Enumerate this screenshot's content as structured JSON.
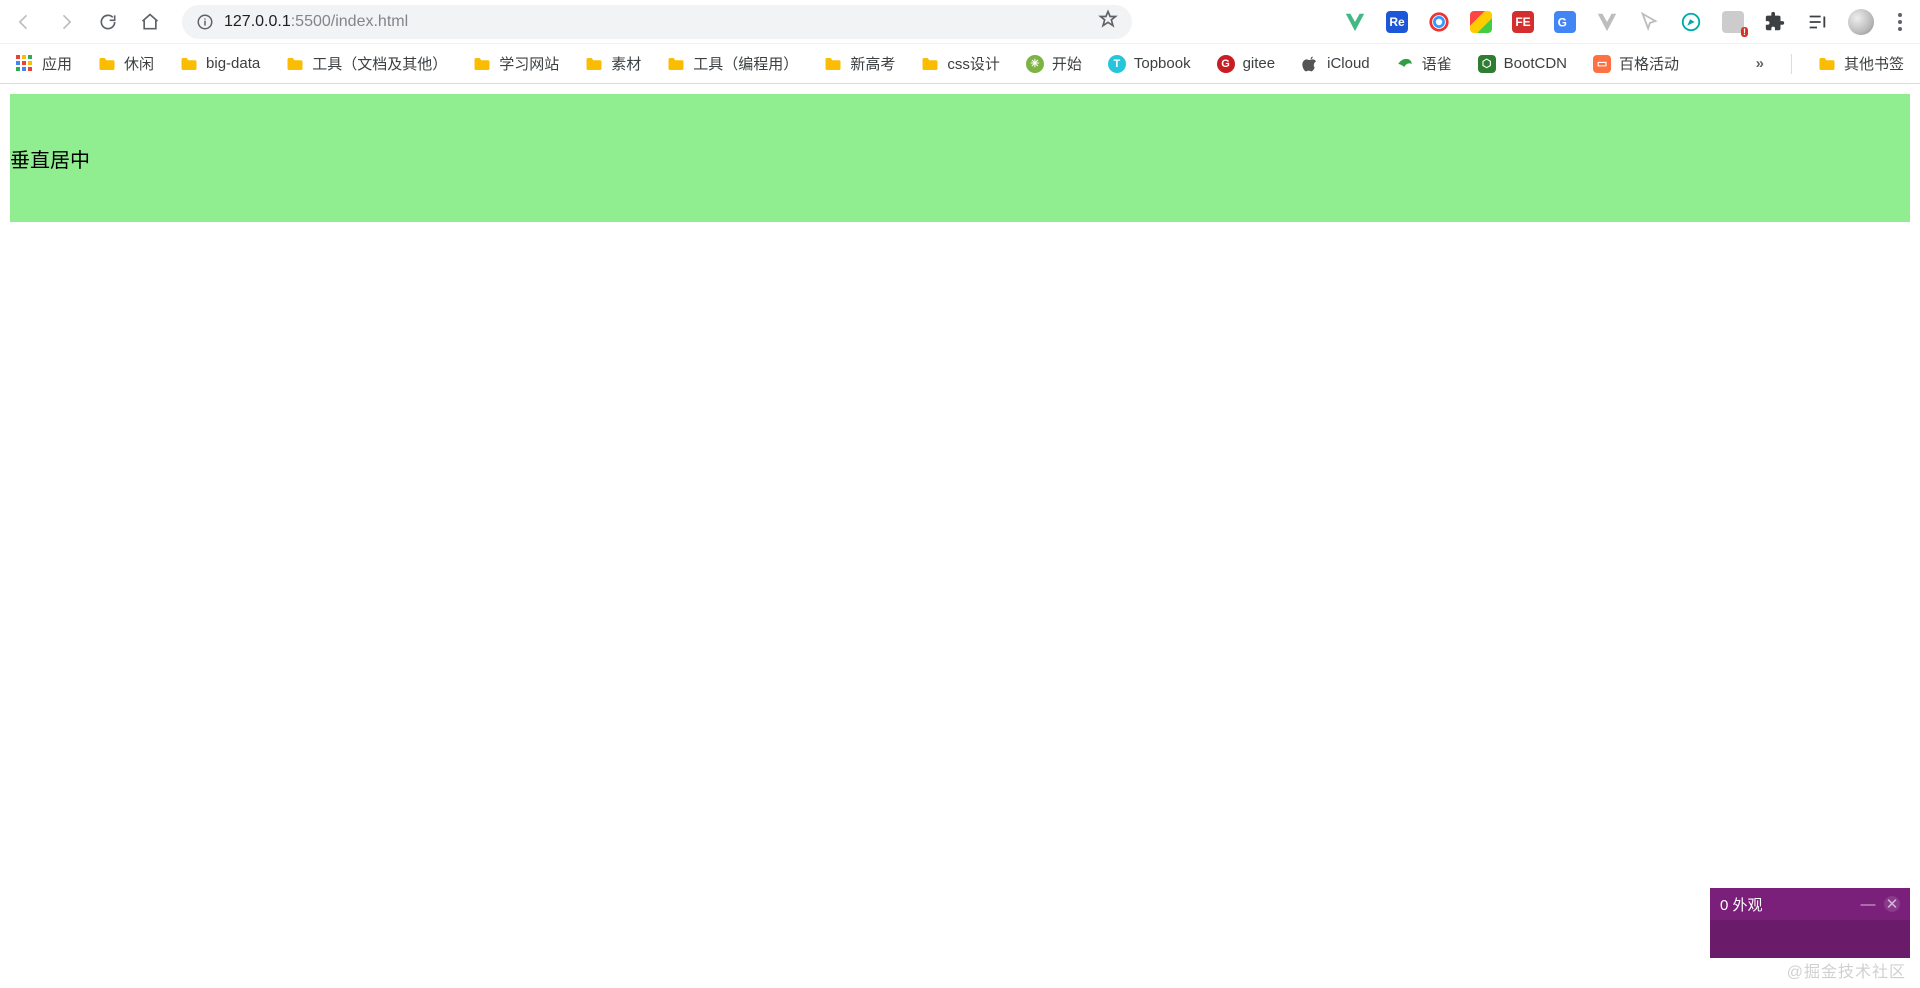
{
  "toolbar": {
    "url_host": "127.0.0.1",
    "url_rest": ":5500/index.html"
  },
  "bookmarks": {
    "apps_label": "应用",
    "items": [
      {
        "label": "休闲",
        "type": "folder"
      },
      {
        "label": "big-data",
        "type": "folder"
      },
      {
        "label": "工具（文档及其他）",
        "type": "folder"
      },
      {
        "label": "学习网站",
        "type": "folder"
      },
      {
        "label": "素材",
        "type": "folder"
      },
      {
        "label": "工具（编程用）",
        "type": "folder"
      },
      {
        "label": "新高考",
        "type": "folder"
      },
      {
        "label": "css设计",
        "type": "folder"
      },
      {
        "label": "开始",
        "type": "link",
        "icon": "green-circle"
      },
      {
        "label": "Topbook",
        "type": "link",
        "icon": "teal-circle"
      },
      {
        "label": "gitee",
        "type": "link",
        "icon": "gitee"
      },
      {
        "label": "iCloud",
        "type": "link",
        "icon": "apple"
      },
      {
        "label": "语雀",
        "type": "link",
        "icon": "yuque"
      },
      {
        "label": "BootCDN",
        "type": "link",
        "icon": "bootcdn"
      },
      {
        "label": "百格活动",
        "type": "link",
        "icon": "orange-box"
      }
    ],
    "overflow_label": "»",
    "other_label": "其他书签"
  },
  "page": {
    "box_text": "垂直居中"
  },
  "panel": {
    "title": "0 外观"
  },
  "watermark": "@掘金技术社区"
}
